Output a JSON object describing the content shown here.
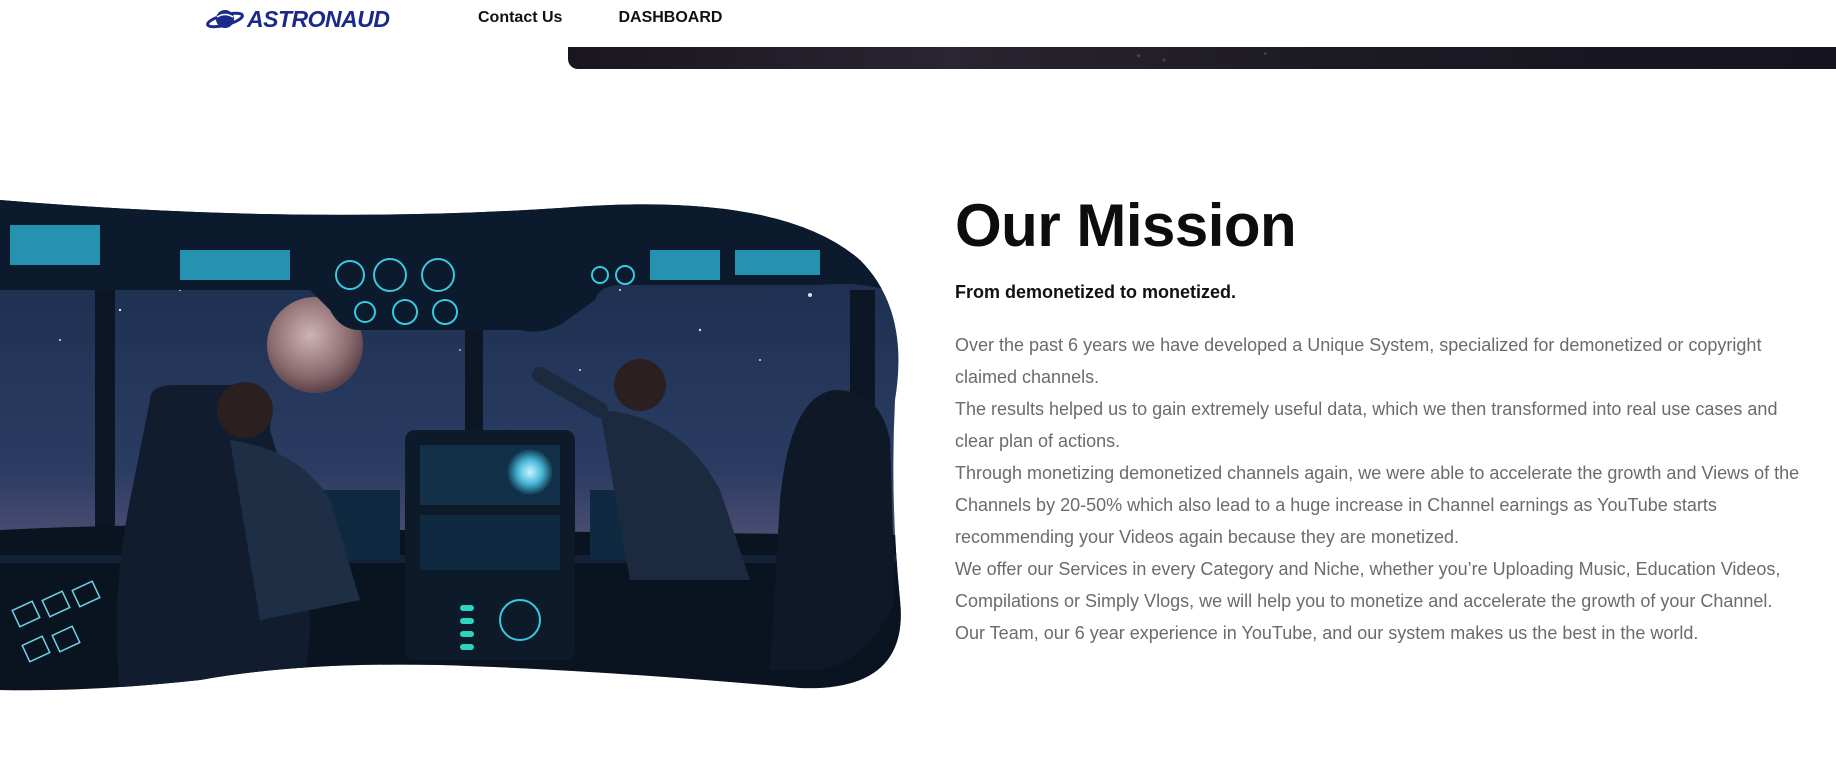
{
  "header": {
    "logo_text": "ASTRONAUD",
    "nav": [
      {
        "label": "Contact Us"
      },
      {
        "label": "DASHBOARD"
      }
    ]
  },
  "mission": {
    "title": "Our Mission",
    "subtitle": "From demonetized to monetized.",
    "paragraphs": [
      "Over the past 6 years we have developed a Unique System, specialized for demonetized or copyright claimed channels.",
      "The results helped us to gain extremely useful data, which we then transformed into real use cases and clear plan of actions.",
      "Through monetizing demonetized channels again, we were able to accelerate the growth and Views of the Channels by 20-50% which also lead to a huge increase in Channel earnings as YouTube starts recommending your Videos again because they are monetized.",
      "We offer our Services in every Category and Niche, whether you’re Uploading Music, Education Videos, Compilations or Simply Vlogs, we will help you to monetize and accelerate the growth of your Channel.",
      "Our Team, our 6 year experience in YouTube, and our system makes us the best in the world."
    ]
  },
  "colors": {
    "brand": "#1b2a8a",
    "text_dark": "#0d0d0d",
    "text_body": "#6b6b6b"
  }
}
